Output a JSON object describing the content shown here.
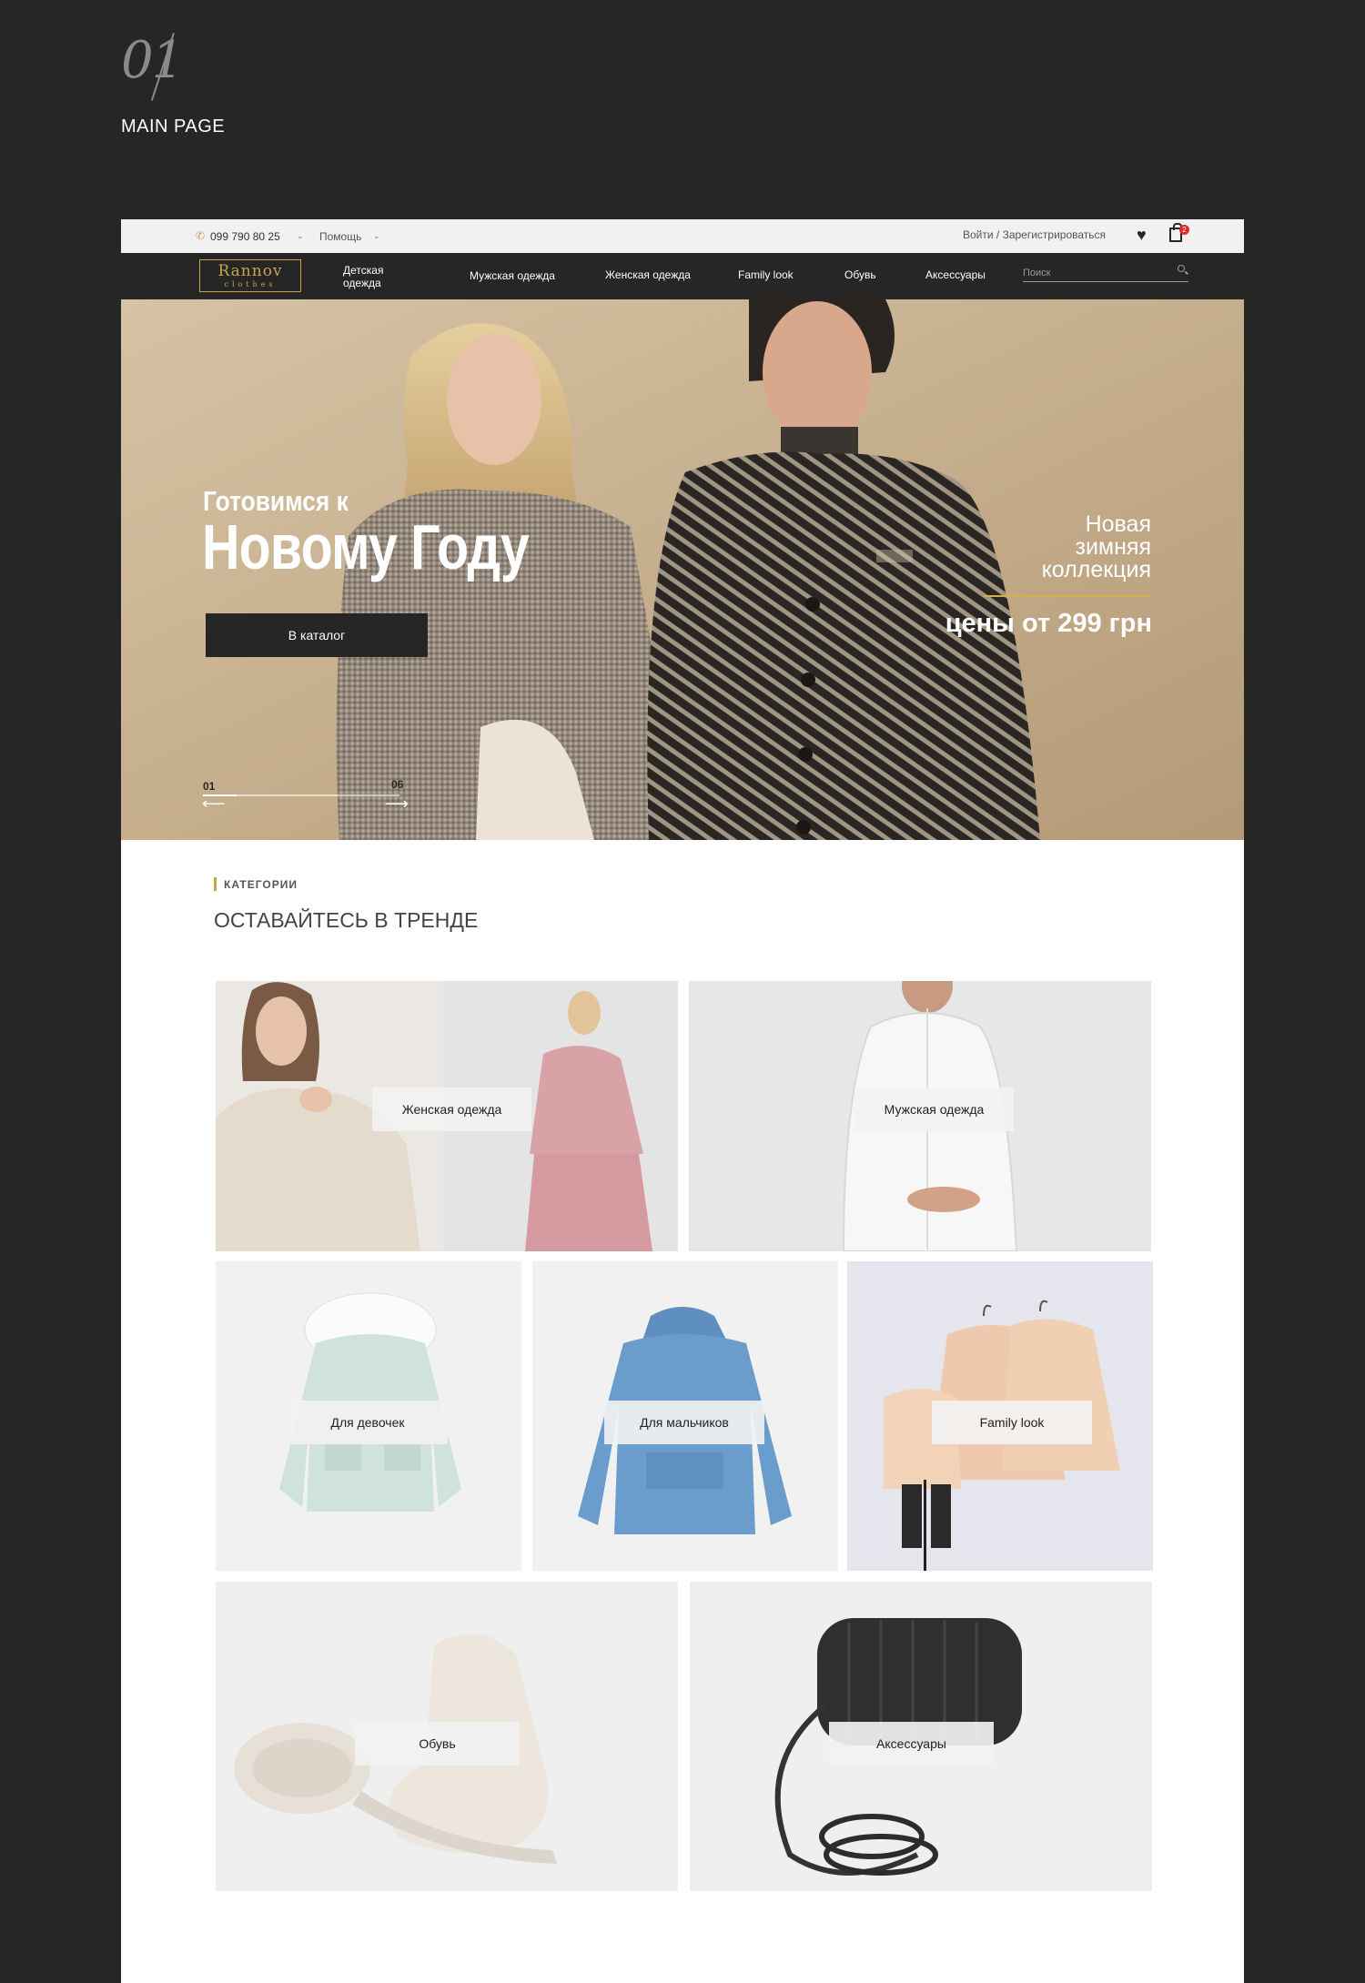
{
  "presentation": {
    "number": "01",
    "title": "MAIN PAGE"
  },
  "topbar": {
    "phone": "099 790 80 25",
    "help": "Помощь",
    "login": "Войти / Зарегистрироваться",
    "cart_count": "2"
  },
  "logo": {
    "name": "Rannov",
    "sub": "clothes"
  },
  "nav": {
    "items": [
      "Детская одежда",
      "Мужская одежда",
      "Женская одежда",
      "Family look",
      "Обувь",
      "Аксессуары"
    ],
    "search_placeholder": "Поиск"
  },
  "hero": {
    "subtitle": "Готовимся к",
    "title": "Новому Году",
    "button": "В каталог",
    "right_lines": [
      "Новая",
      "зимняя",
      "коллекция"
    ],
    "price": "цены от 299 грн",
    "slide_current": "01",
    "slide_total": "06",
    "slide_progress": 0.17
  },
  "categories": {
    "label": "КАТЕГОРИИ",
    "heading": "ОСТАВАЙТЕСЬ В ТРЕНДЕ",
    "tiles": [
      {
        "label": "Женская одежда"
      },
      {
        "label": "Мужская  одежда"
      },
      {
        "label": "Для девочек"
      },
      {
        "label": "Для мальчиков"
      },
      {
        "label": "Family look"
      },
      {
        "label": "Обувь"
      },
      {
        "label": "Аксессуары"
      }
    ]
  },
  "colors": {
    "background": "#262626",
    "accent_gold": "#c9a44c",
    "badge_red": "#e5262b"
  }
}
